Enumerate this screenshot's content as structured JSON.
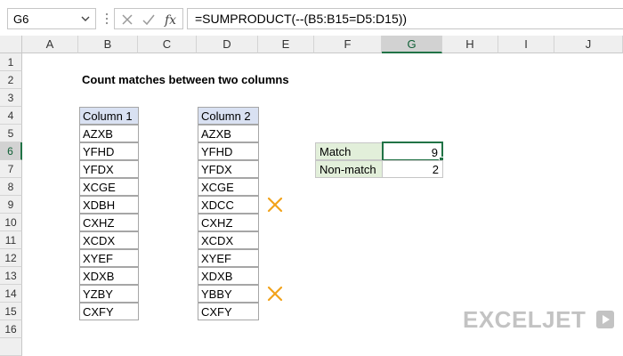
{
  "formula_bar": {
    "name_box": "G6",
    "formula": "=SUMPRODUCT(--(B5:B15=D5:D15))",
    "icons": [
      "chevron-down-icon",
      "cancel-icon",
      "confirm-icon",
      "fx-icon"
    ]
  },
  "columns": [
    "A",
    "B",
    "C",
    "D",
    "E",
    "F",
    "G",
    "H",
    "I",
    "J"
  ],
  "rows": [
    "1",
    "2",
    "3",
    "4",
    "5",
    "6",
    "7",
    "8",
    "9",
    "10",
    "11",
    "12",
    "13",
    "14",
    "15",
    "16"
  ],
  "sheet": {
    "title": "Count matches between two columns",
    "col1": {
      "header": "Column 1",
      "values": [
        "AZXB",
        "YFHD",
        "YFDX",
        "XCGE",
        "XDBH",
        "CXHZ",
        "XCDX",
        "XYEF",
        "XDXB",
        "YZBY",
        "CXFY"
      ]
    },
    "col2": {
      "header": "Column 2",
      "values": [
        "AZXB",
        "YFHD",
        "YFDX",
        "XCGE",
        "XDCC",
        "CXHZ",
        "XCDX",
        "XYEF",
        "XDXB",
        "YBBY",
        "CXFY"
      ]
    },
    "summary": {
      "match_label": "Match",
      "match_value": "9",
      "nonmatch_label": "Non-match",
      "nonmatch_value": "2"
    },
    "mismatch_rows": [
      9,
      14
    ]
  },
  "colors": {
    "selection": "#217346",
    "header_fill": "#d9e1f2",
    "label_fill": "#e2efda",
    "x_mark": "#f2a31b",
    "logo": "#c0c0c0"
  },
  "logo": "EXCELJET"
}
